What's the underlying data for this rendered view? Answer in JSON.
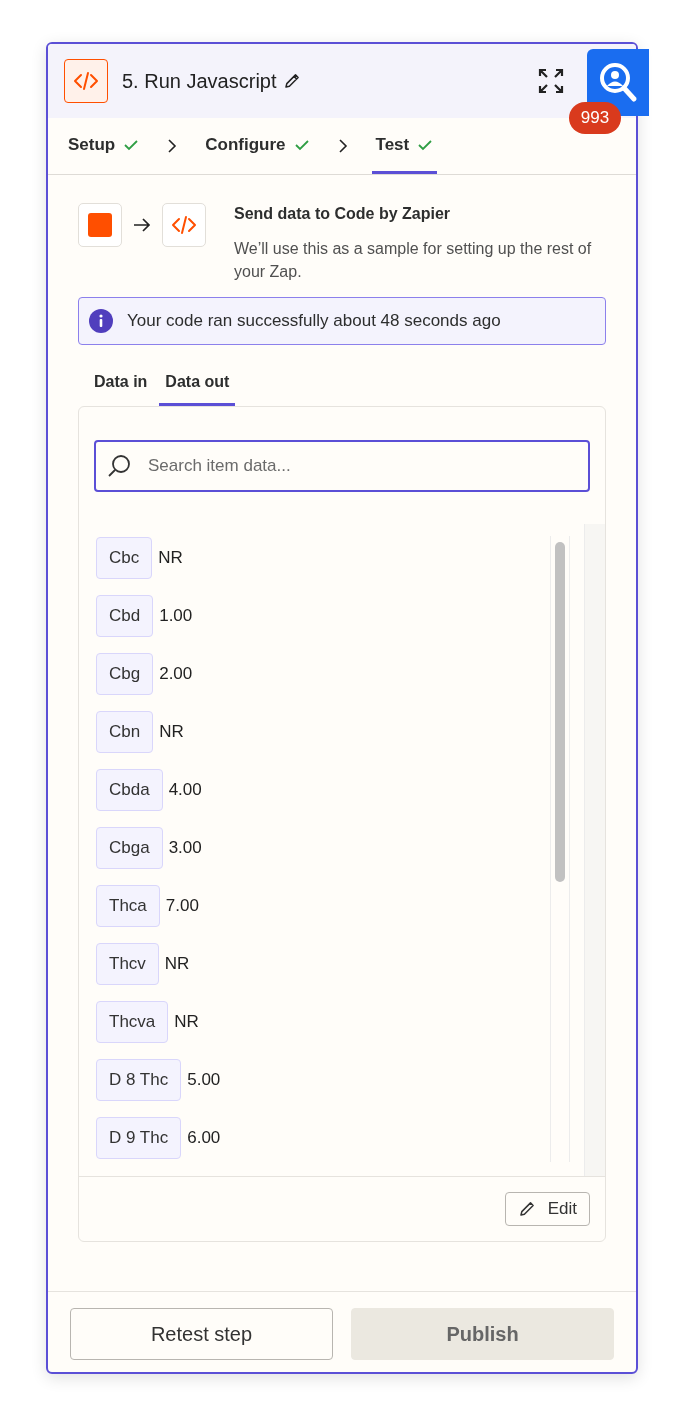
{
  "header": {
    "title": "5. Run Javascript",
    "badge": "993"
  },
  "steps": [
    {
      "label": "Setup",
      "done": true,
      "selected": false
    },
    {
      "label": "Configure",
      "done": true,
      "selected": false
    },
    {
      "label": "Test",
      "done": true,
      "selected": true
    }
  ],
  "source": {
    "title": "Send data to Code by Zapier",
    "description": "We’ll use this as a sample for setting up the rest of your Zap."
  },
  "alert": "Your code ran successfully about 48 seconds ago",
  "data_tabs": [
    {
      "label": "Data in",
      "selected": false
    },
    {
      "label": "Data out",
      "selected": true
    }
  ],
  "search": {
    "placeholder": "Search item data..."
  },
  "items": [
    {
      "key": "Cbc",
      "value": "NR"
    },
    {
      "key": "Cbd",
      "value": "1.00"
    },
    {
      "key": "Cbg",
      "value": "2.00"
    },
    {
      "key": "Cbn",
      "value": "NR"
    },
    {
      "key": "Cbda",
      "value": "4.00"
    },
    {
      "key": "Cbga",
      "value": "3.00"
    },
    {
      "key": "Thca",
      "value": "7.00"
    },
    {
      "key": "Thcv",
      "value": "NR"
    },
    {
      "key": "Thcva",
      "value": "NR"
    },
    {
      "key": "D 8 Thc",
      "value": "5.00"
    },
    {
      "key": "D 9 Thc",
      "value": "6.00"
    }
  ],
  "edit_button": "Edit",
  "footer": [
    {
      "label": "Retest step",
      "disabled": false
    },
    {
      "label": "Publish",
      "disabled": true
    }
  ]
}
